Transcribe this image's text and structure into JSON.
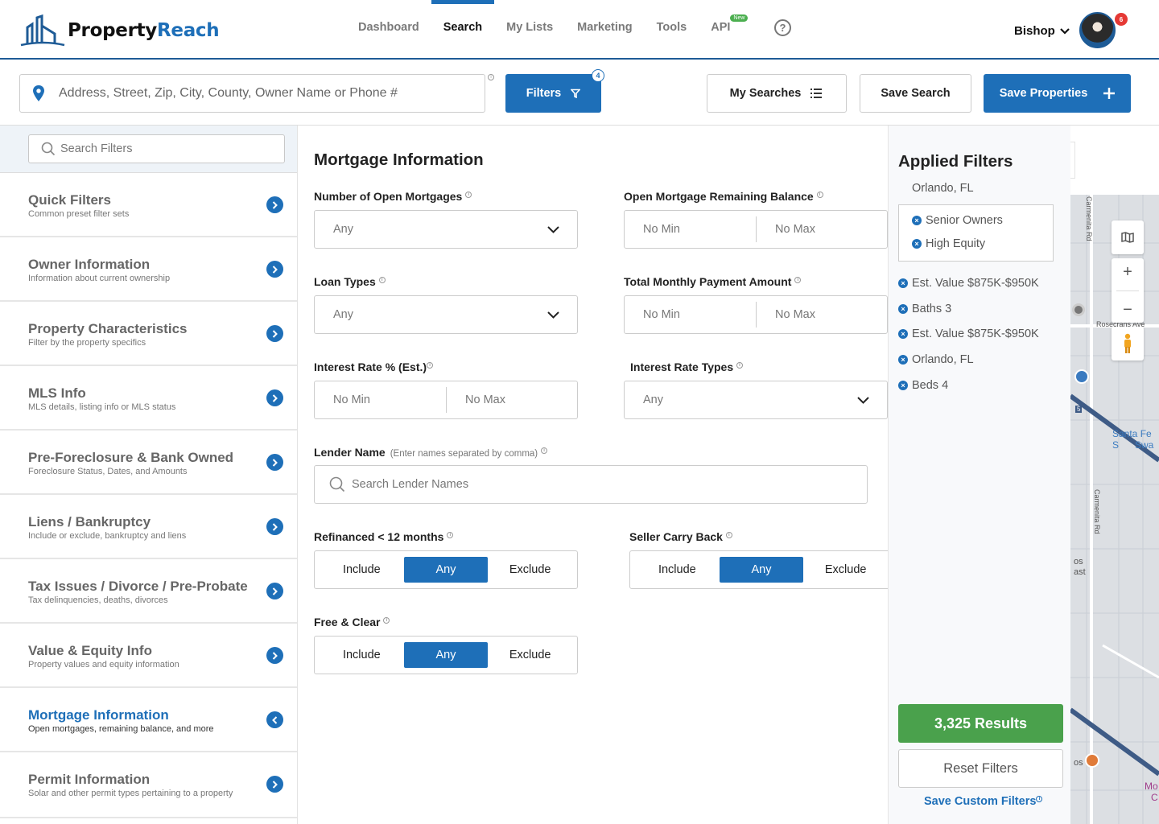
{
  "brand": {
    "name_part1": "Property",
    "name_part2": "Reach"
  },
  "nav": {
    "items": [
      {
        "label": "Dashboard",
        "active": false
      },
      {
        "label": "Search",
        "active": true
      },
      {
        "label": "My Lists",
        "active": false
      },
      {
        "label": "Marketing",
        "active": false
      },
      {
        "label": "Tools",
        "active": false
      },
      {
        "label": "API",
        "active": false,
        "badge": "New"
      }
    ],
    "help_icon": "?"
  },
  "user": {
    "name": "Bishop",
    "notifications": "6"
  },
  "search_bar": {
    "placeholder": "Address, Street, Zip, City, County, Owner Name or Phone #",
    "filters_label": "Filters",
    "filters_count": "4",
    "my_searches_label": "My Searches",
    "save_search_label": "Save Search",
    "save_properties_label": "Save Properties"
  },
  "sidebar": {
    "search_placeholder": "Search Filters",
    "items": [
      {
        "title": "Quick Filters",
        "subtitle": "Common preset filter sets"
      },
      {
        "title": "Owner Information",
        "subtitle": "Information about current ownership"
      },
      {
        "title": "Property Characteristics",
        "subtitle": "Filter by the property specifics"
      },
      {
        "title": "MLS Info",
        "subtitle": "MLS details, listing info or MLS status"
      },
      {
        "title": "Pre-Foreclosure & Bank Owned",
        "subtitle": "Foreclosure Status, Dates, and Amounts"
      },
      {
        "title": "Liens / Bankruptcy",
        "subtitle": "Include or exclude, bankruptcy and liens"
      },
      {
        "title": "Tax Issues / Divorce / Pre-Probate",
        "subtitle": "Tax delinquencies, deaths, divorces"
      },
      {
        "title": "Value & Equity Info",
        "subtitle": "Property values and equity information"
      },
      {
        "title": "Mortgage Information",
        "subtitle": "Open mortgages, remaining balance, and more"
      },
      {
        "title": "Permit Information",
        "subtitle": "Solar and other permit types pertaining to a property"
      }
    ]
  },
  "form": {
    "title": "Mortgage Information",
    "open_mortgages": {
      "label": "Number of Open Mortgages",
      "value": "Any"
    },
    "remaining_balance": {
      "label": "Open Mortgage Remaining Balance",
      "min": "No Min",
      "max": "No Max"
    },
    "loan_types": {
      "label": "Loan Types",
      "value": "Any"
    },
    "monthly_payment": {
      "label": "Total Monthly Payment Amount",
      "min": "No Min",
      "max": "No Max"
    },
    "interest_rate": {
      "label": "Interest Rate % (Est.)",
      "min": "No Min",
      "max": "No Max"
    },
    "interest_rate_types": {
      "label": "Interest Rate Types",
      "value": "Any"
    },
    "lender": {
      "label": "Lender Name",
      "hint": "(Enter names separated by comma)",
      "placeholder": "Search Lender Names"
    },
    "refinanced": {
      "label": "Refinanced < 12 months",
      "options": [
        "Include",
        "Any",
        "Exclude"
      ],
      "selected": "Any"
    },
    "seller_carry_back": {
      "label": "Seller Carry Back",
      "options": [
        "Include",
        "Any",
        "Exclude"
      ],
      "selected": "Any"
    },
    "free_clear": {
      "label": "Free & Clear",
      "options": [
        "Include",
        "Any",
        "Exclude"
      ],
      "selected": "Any"
    }
  },
  "applied": {
    "title": "Applied Filters",
    "location": "Orlando, FL",
    "grouped": [
      "Senior Owners",
      "High Equity"
    ],
    "chips": [
      "Est. Value $875K-$950K",
      "Baths 3",
      "Est. Value $875K-$950K",
      "Orlando, FL",
      "Beds 4"
    ],
    "results_label": "3,325 Results",
    "reset_label": "Reset Filters",
    "custom_label": "Save Custom Filters"
  },
  "map": {
    "labels": [
      "Carmenita Rd",
      "Rosecrans Ave",
      "Santa Fe S",
      "Swa",
      "Carmenita Rd",
      "os",
      "ast",
      "os",
      "Mo",
      "C",
      "5"
    ]
  },
  "colors": {
    "brand_blue": "#1e6fb8",
    "results_green": "#4aa14c",
    "notif_red": "#e53935"
  }
}
